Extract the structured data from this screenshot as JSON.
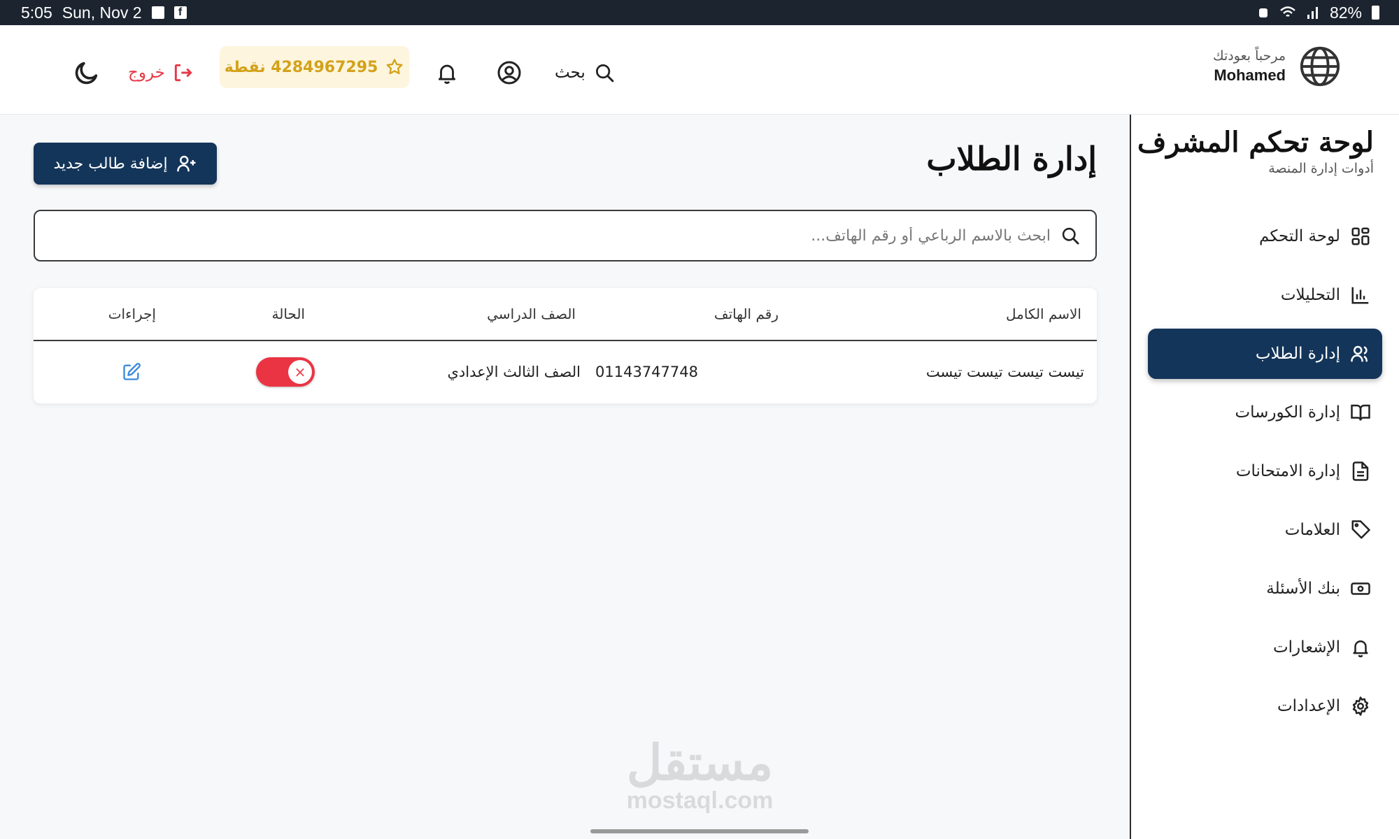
{
  "status_bar": {
    "time": "5:05",
    "date": "Sun, Nov 2",
    "battery": "82%"
  },
  "header": {
    "welcome": "مرحباً بعودتك",
    "user_name": "Mohamed",
    "search_label": "بحث",
    "points_label": "4284967295 نقطة",
    "logout_label": "خروج"
  },
  "sidebar": {
    "title": "لوحة تحكم المشرف",
    "subtitle": "أدوات إدارة المنصة",
    "items": [
      {
        "label": "لوحة التحكم",
        "icon": "dashboard-icon",
        "active": false
      },
      {
        "label": "التحليلات",
        "icon": "analytics-icon",
        "active": false
      },
      {
        "label": "إدارة الطلاب",
        "icon": "users-icon",
        "active": true
      },
      {
        "label": "إدارة الكورسات",
        "icon": "book-icon",
        "active": false
      },
      {
        "label": "إدارة الامتحانات",
        "icon": "document-icon",
        "active": false
      },
      {
        "label": "العلامات",
        "icon": "tag-icon",
        "active": false
      },
      {
        "label": "بنك الأسئلة",
        "icon": "bank-icon",
        "active": false
      },
      {
        "label": "الإشعارات",
        "icon": "bell-icon",
        "active": false
      },
      {
        "label": "الإعدادات",
        "icon": "gear-icon",
        "active": false
      }
    ]
  },
  "main": {
    "title": "إدارة الطلاب",
    "add_button": "إضافة طالب جديد",
    "search_placeholder": "ابحث بالاسم الرباعي أو رقم الهاتف...",
    "table": {
      "headers": [
        "الاسم الكامل",
        "رقم الهاتف",
        "الصف الدراسي",
        "الحالة",
        "إجراءات"
      ],
      "rows": [
        {
          "name": "تيست تيست تيست تيست",
          "phone": "01143747748",
          "grade": "الصف الثالث الإعدادي",
          "status_active": false
        }
      ]
    }
  },
  "watermark": {
    "arabic": "مستقل",
    "latin": "mostaql.com"
  },
  "colors": {
    "primary": "#14355a",
    "danger": "#e53947",
    "toggle_off": "#ea3443",
    "points_text": "#d3a21a",
    "points_bg": "#fdf5dd",
    "edit_icon": "#3a8ad8"
  }
}
